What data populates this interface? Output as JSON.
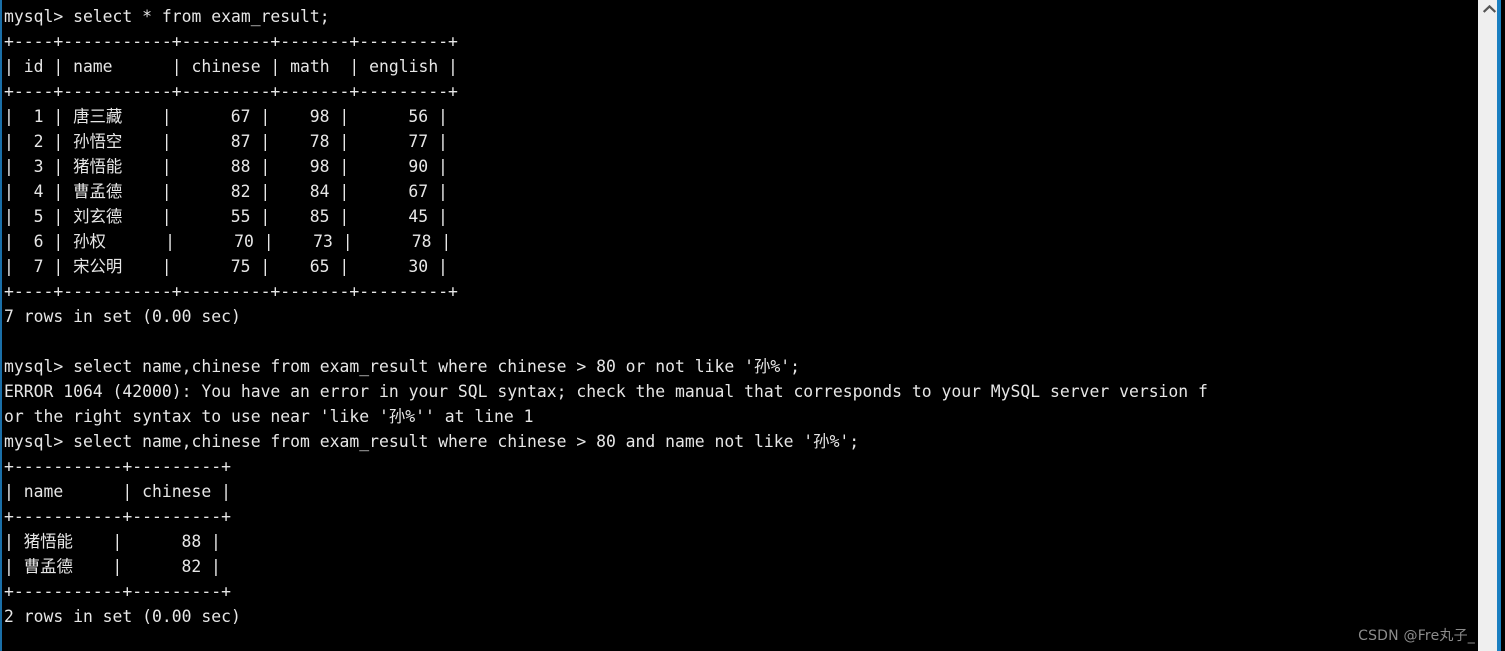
{
  "window": {
    "title": "mysql client terminal",
    "background_color": "#000000",
    "foreground_color": "#e6e6e6",
    "accent_color": "#1a7fc1"
  },
  "scrollbar": {
    "track_color": "#efefef",
    "up_arrow_icon": "chevron-up-icon"
  },
  "watermark": {
    "text": "CSDN @Fre丸子_"
  },
  "console": {
    "prompt": "mysql> ",
    "lines": [
      "mysql> select * from exam_result;",
      "+----+-----------+---------+-------+---------+",
      "| id | name      | chinese | math  | english |",
      "+----+-----------+---------+-------+---------+",
      "|  1 | 唐三藏    |      67 |    98 |      56 |",
      "|  2 | 孙悟空    |      87 |    78 |      77 |",
      "|  3 | 猪悟能    |      88 |    98 |      90 |",
      "|  4 | 曹孟德    |      82 |    84 |      67 |",
      "|  5 | 刘玄德    |      55 |    85 |      45 |",
      "|  6 | 孙权      |      70 |    73 |      78 |",
      "|  7 | 宋公明    |      75 |    65 |      30 |",
      "+----+-----------+---------+-------+---------+",
      "7 rows in set (0.00 sec)",
      "",
      "mysql> select name,chinese from exam_result where chinese > 80 or not like '孙%';",
      "ERROR 1064 (42000): You have an error in your SQL syntax; check the manual that corresponds to your MySQL server version f",
      "or the right syntax to use near 'like '孙%'' at line 1",
      "mysql> select name,chinese from exam_result where chinese > 80 and name not like '孙%';",
      "+-----------+---------+",
      "| name      | chinese |",
      "+-----------+---------+",
      "| 猪悟能    |      88 |",
      "| 曹孟德    |      82 |",
      "+-----------+---------+",
      "2 rows in set (0.00 sec)"
    ],
    "queries": [
      {
        "sql": "select * from exam_result;",
        "status": "7 rows in set (0.00 sec)",
        "columns": [
          "id",
          "name",
          "chinese",
          "math",
          "english"
        ],
        "rows": [
          [
            "1",
            "唐三藏",
            "67",
            "98",
            "56"
          ],
          [
            "2",
            "孙悟空",
            "87",
            "78",
            "77"
          ],
          [
            "3",
            "猪悟能",
            "88",
            "98",
            "90"
          ],
          [
            "4",
            "曹孟德",
            "82",
            "84",
            "67"
          ],
          [
            "5",
            "刘玄德",
            "55",
            "85",
            "45"
          ],
          [
            "6",
            "孙权",
            "70",
            "73",
            "78"
          ],
          [
            "7",
            "宋公明",
            "75",
            "65",
            "30"
          ]
        ]
      },
      {
        "sql": "select name,chinese from exam_result where chinese > 80 or not like '孙%';",
        "error_code": "ERROR 1064 (42000)",
        "error_message": "You have an error in your SQL syntax; check the manual that corresponds to your MySQL server version for the right syntax to use near 'like '孙%'' at line 1"
      },
      {
        "sql": "select name,chinese from exam_result where chinese > 80 and name not like '孙%';",
        "status": "2 rows in set (0.00 sec)",
        "columns": [
          "name",
          "chinese"
        ],
        "rows": [
          [
            "猪悟能",
            "88"
          ],
          [
            "曹孟德",
            "82"
          ]
        ]
      }
    ]
  }
}
